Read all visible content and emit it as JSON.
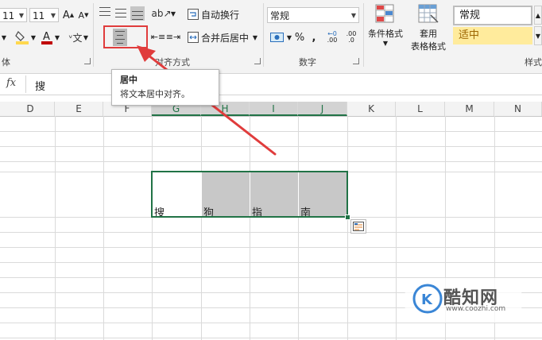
{
  "ribbon": {
    "font": {
      "size_value": "11",
      "group_label": "体"
    },
    "alignment": {
      "wrap_text_label": "自动换行",
      "merge_center_label": "合并后居中",
      "group_label": "对齐方式"
    },
    "number": {
      "format_value": "常规",
      "group_label": "数字",
      "percent_symbol": "%",
      "comma_symbol": ",",
      "increase_decimal_label": ".00",
      "decrease_decimal_label": ".0"
    },
    "styles": {
      "conditional_format_label": "条件格式",
      "format_as_table_line1": "套用",
      "format_as_table_line2": "表格格式",
      "normal_style_label": "常规",
      "neutral_style_label": "适中",
      "group_label": "样式"
    },
    "colors": {
      "highlight": "#ffd84f",
      "font_color": "#c00000",
      "neutral_fill": "#ffeb9c",
      "neutral_text": "#9c6500",
      "excel_green": "#217346",
      "red_annotation": "#e03c3c"
    }
  },
  "tooltip": {
    "title": "居中",
    "description": "将文本居中对齐。"
  },
  "formula_bar": {
    "fx_label": "fx",
    "value": "搜"
  },
  "columns": [
    "D",
    "E",
    "F",
    "G",
    "H",
    "I",
    "J",
    "K",
    "L",
    "M",
    "N"
  ],
  "cells": [
    "搜",
    "狗",
    "指",
    "南"
  ],
  "cell_fill": "#c8c8c8",
  "watermark": {
    "brand": "酷知网",
    "url": "www.coozhi.com"
  }
}
